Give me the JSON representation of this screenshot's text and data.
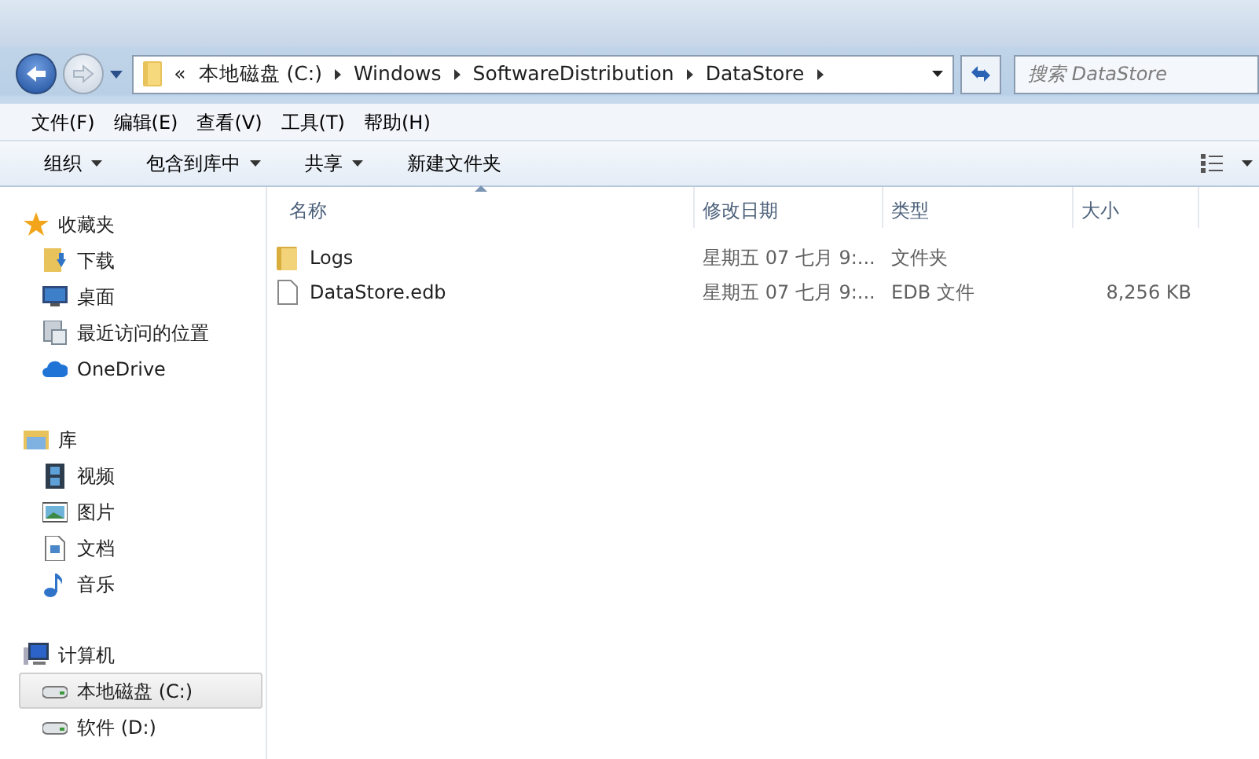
{
  "nav": {
    "back_enabled": true,
    "forward_enabled": false
  },
  "address": {
    "overflow": "«",
    "segments": [
      "本地磁盘 (C:)",
      "Windows",
      "SoftwareDistribution",
      "DataStore"
    ]
  },
  "search": {
    "placeholder": "搜索 DataStore"
  },
  "menu": [
    "文件(F)",
    "编辑(E)",
    "查看(V)",
    "工具(T)",
    "帮助(H)"
  ],
  "toolbar": [
    {
      "label": "组织",
      "dropdown": true
    },
    {
      "label": "包含到库中",
      "dropdown": true
    },
    {
      "label": "共享",
      "dropdown": true
    },
    {
      "label": "新建文件夹",
      "dropdown": false
    }
  ],
  "sidebar": [
    {
      "label": "收藏夹",
      "children": [
        {
          "label": "下载",
          "selected": false
        },
        {
          "label": "桌面",
          "selected": false
        },
        {
          "label": "最近访问的位置",
          "selected": false
        },
        {
          "label": "OneDrive",
          "selected": false
        }
      ]
    },
    {
      "label": "库",
      "children": [
        {
          "label": "视频",
          "selected": false
        },
        {
          "label": "图片",
          "selected": false
        },
        {
          "label": "文档",
          "selected": false
        },
        {
          "label": "音乐",
          "selected": false
        }
      ]
    },
    {
      "label": "计算机",
      "children": [
        {
          "label": "本地磁盘 (C:)",
          "selected": true
        },
        {
          "label": "软件 (D:)",
          "selected": false
        }
      ]
    }
  ],
  "columns": [
    {
      "label": "名称",
      "sorted": true
    },
    {
      "label": "修改日期",
      "sorted": false
    },
    {
      "label": "类型",
      "sorted": false
    },
    {
      "label": "大小",
      "sorted": false
    }
  ],
  "files": [
    {
      "kind": "folder",
      "name": "Logs",
      "date": "星期五 07 七月 9:...",
      "type": "文件夹"
    },
    {
      "kind": "file",
      "name": "DataStore.edb",
      "date": "星期五 07 七月 9:...",
      "type": "EDB 文件",
      "size": "8,256 KB"
    }
  ]
}
